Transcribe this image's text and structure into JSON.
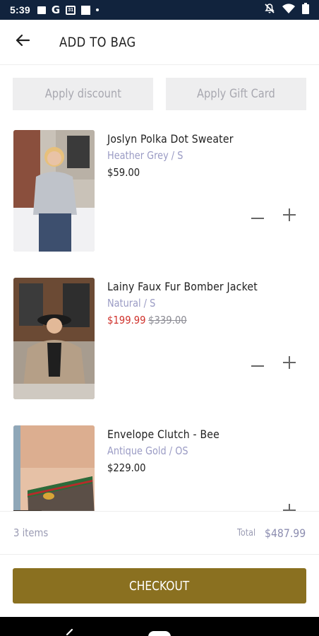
{
  "status_bar": {
    "time": "5:39",
    "left_icons": [
      "photo-icon",
      "google-g-icon",
      "calendar-icon",
      "square-icon",
      "dot-icon"
    ],
    "calendar_day": "31",
    "google_letter": "G",
    "right_icons": [
      "mute-icon",
      "wifi-icon",
      "battery-icon"
    ]
  },
  "header": {
    "back_icon": "arrow-left-icon",
    "title": "ADD TO BAG"
  },
  "promos": {
    "discount_label": "Apply discount",
    "gift_card_label": "Apply Gift Card"
  },
  "items": [
    {
      "name": "Joslyn Polka Dot Sweater",
      "variant": "Heather Grey / S",
      "price": "$59.00"
    },
    {
      "name": "Lainy Faux Fur Bomber Jacket",
      "variant": "Natural / S",
      "sale_price": "$199.99",
      "original_price": "$339.00"
    },
    {
      "name": "Envelope Clutch - Bee",
      "variant": "Antique Gold / OS",
      "price": "$229.00"
    }
  ],
  "summary": {
    "item_count": "3 items",
    "total_label": "Total",
    "total_value": "$487.99"
  },
  "checkout_label": "CHECKOUT",
  "colors": {
    "status_bar": "#11233d",
    "accent_gold": "#8a7020",
    "variant_text": "#9a9bc4",
    "sale_red": "#d0332d",
    "promo_bg": "#eeeeef"
  }
}
